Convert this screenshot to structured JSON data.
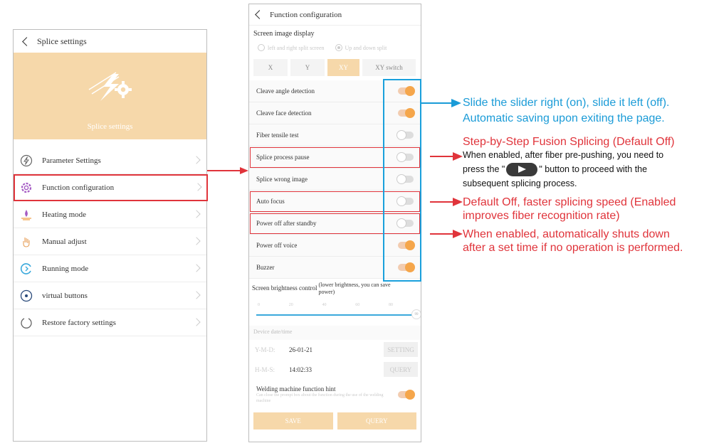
{
  "left_screen": {
    "header_title": "Splice settings",
    "banner_title": "Splice settings",
    "menu": [
      {
        "label": "Parameter Settings",
        "icon": "lightning-circle-icon"
      },
      {
        "label": "Function configuration",
        "icon": "gear-icon"
      },
      {
        "label": "Heating mode",
        "icon": "flame-icon"
      },
      {
        "label": "Manual adjust",
        "icon": "hand-icon"
      },
      {
        "label": "Running mode",
        "icon": "running-mode-icon"
      },
      {
        "label": "virtual buttons",
        "icon": "target-dot-icon"
      },
      {
        "label": "Restore factory settings",
        "icon": "restore-icon"
      }
    ]
  },
  "mid_screen": {
    "header_title": "Function configuration",
    "screen_image_title": "Screen image display",
    "radio_left": "left and right split screen",
    "radio_right": "Up and down split",
    "segments": [
      "X",
      "Y",
      "XY",
      "XY switch"
    ],
    "toggles": [
      {
        "label": "Cleave angle detection",
        "on": true
      },
      {
        "label": "Cleave face detection",
        "on": true
      },
      {
        "label": "Fiber tensile test",
        "on": false
      },
      {
        "label": "Splice process pause",
        "on": false
      },
      {
        "label": "Splice wrong image",
        "on": false
      },
      {
        "label": "Auto focus",
        "on": false
      },
      {
        "label": "Power off after standby",
        "on": false
      },
      {
        "label": "Power off voice",
        "on": true
      },
      {
        "label": "Buzzer",
        "on": true
      }
    ],
    "brightness_title": "Screen brightness control",
    "brightness_note": "(lower brightness, you can save power)",
    "brightness_ticks": [
      "0",
      "20",
      "40",
      "60",
      "80"
    ],
    "brightness_value": "99",
    "device_datetime_title": "Device date/time",
    "ymd_label": "Y-M-D:",
    "ymd_value": "26-01-21",
    "setting_button": "SETTING",
    "hms_label": "H-M-S:",
    "hms_value": "14:02:33",
    "query_button": "QUERY",
    "hint_title": "Welding machine function hint",
    "hint_desc": "Can close the prompt box about the function during the use of the welding machine",
    "hint_on": true,
    "save_button": "SAVE",
    "query_button_bottom": "QUERY"
  },
  "annotations": {
    "slider_line1": "Slide the slider right (on), slide it left (off).",
    "slider_line2": "Automatic saving upon exiting the page.",
    "pause_title": "Step-by-Step Fusion Splicing (Default Off)",
    "pause_line1": "When enabled, after fiber pre-pushing, you need to",
    "pause_line2a": "press the \"",
    "pause_line2b": "\" button to proceed with the",
    "pause_line3": "subsequent splicing process.",
    "focus_line1": "Default Off, faster splicing speed (Enabled",
    "focus_line2": "improves fiber recognition rate)",
    "standby_line1": "When enabled, automatically shuts down",
    "standby_line2": "after a set time if no operation is performed."
  },
  "colors": {
    "accent_orange": "#f5a64b",
    "banner": "#f6d8aa",
    "highlight_red": "#e0343b",
    "highlight_blue": "#1aa0dc"
  }
}
